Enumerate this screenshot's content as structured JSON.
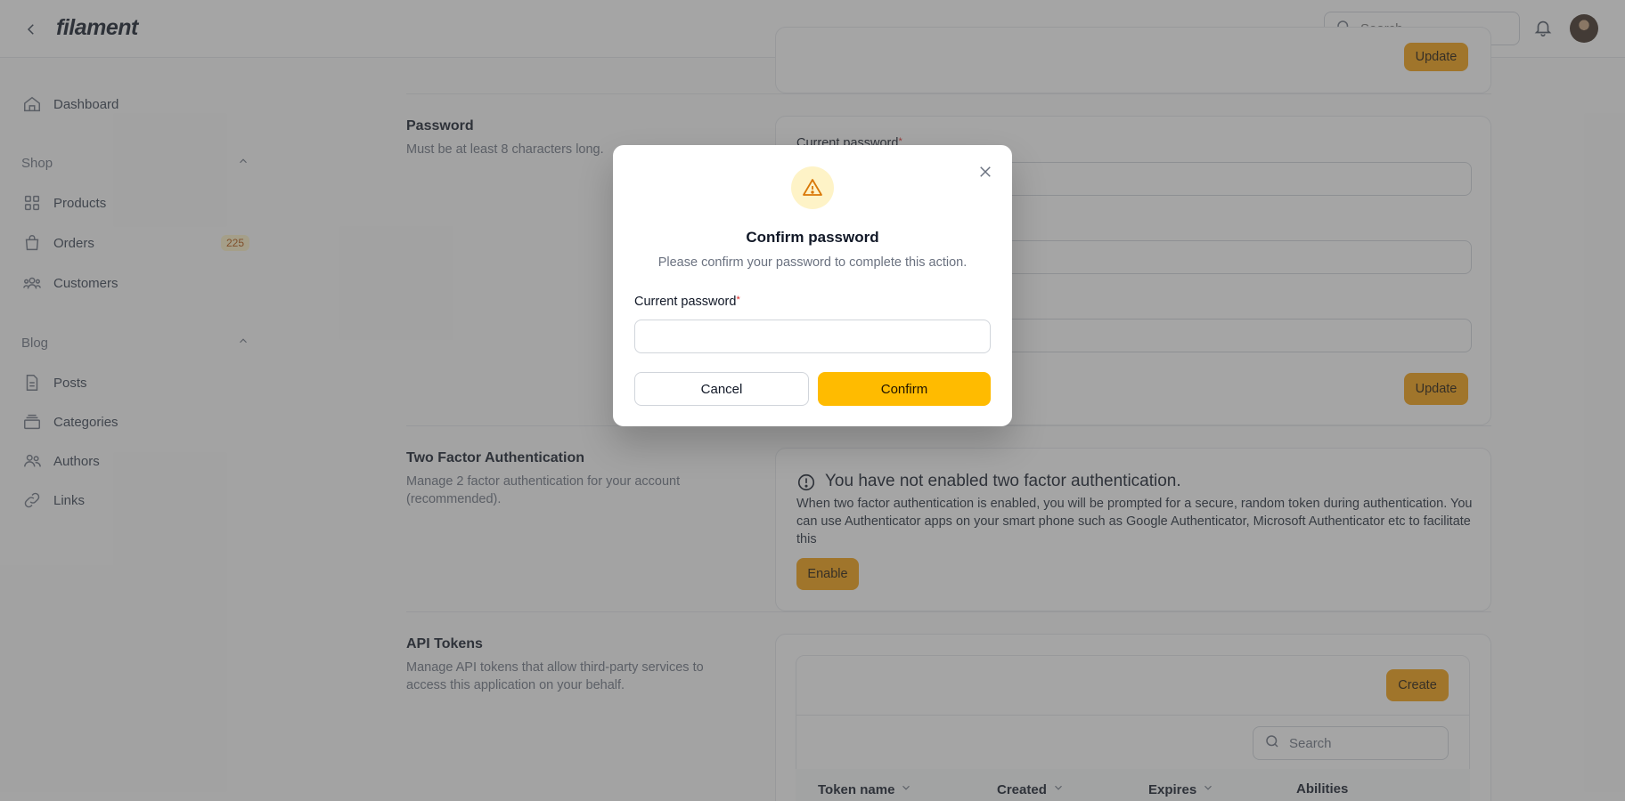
{
  "app": {
    "brand": "filament"
  },
  "topbar": {
    "search_placeholder": "Search"
  },
  "sidebar": {
    "dashboard": "Dashboard",
    "groups": [
      {
        "label": "Shop",
        "items": [
          {
            "label": "Products"
          },
          {
            "label": "Orders",
            "badge": "225"
          },
          {
            "label": "Customers"
          }
        ]
      },
      {
        "label": "Blog",
        "items": [
          {
            "label": "Posts"
          },
          {
            "label": "Categories"
          },
          {
            "label": "Authors"
          },
          {
            "label": "Links"
          }
        ]
      }
    ]
  },
  "main": {
    "top_update": "Update",
    "password": {
      "title": "Password",
      "desc": "Must be at least 8 characters long.",
      "field_label": "Current password",
      "update": "Update"
    },
    "twofa": {
      "title": "Two Factor Authentication",
      "desc": "Manage 2 factor authentication for your account (recommended).",
      "alert_title": "You have not enabled two factor authentication.",
      "alert_body": "When two factor authentication is enabled, you will be prompted for a secure, random token during authentication. You can use Authenticator apps on your smart phone such as Google Authenticator, Microsoft Authenticator etc to facilitate this",
      "enable": "Enable"
    },
    "api": {
      "title": "API Tokens",
      "desc": "Manage API tokens that allow third-party services to access this application on your behalf.",
      "create": "Create",
      "search_placeholder": "Search",
      "columns": [
        "Token name",
        "Created",
        "Expires",
        "Abilities"
      ]
    }
  },
  "modal": {
    "title": "Confirm password",
    "desc": "Please confirm your password to complete this action.",
    "field_label": "Current password",
    "required_mark": "*",
    "cancel": "Cancel",
    "confirm": "Confirm"
  },
  "colors": {
    "accent": "#ffbb00",
    "warning_bg": "#fef3c7",
    "warning_icon": "#d97706"
  }
}
